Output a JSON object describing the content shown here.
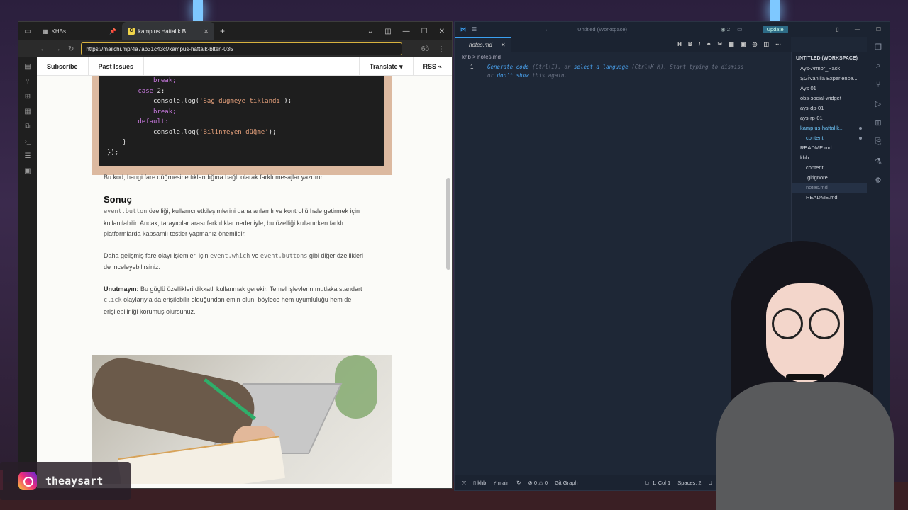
{
  "browser": {
    "tabs": [
      {
        "label": "KHBs",
        "active": false
      },
      {
        "label": "kamp.us Haftalık B...",
        "active": true
      }
    ],
    "url": "https://mailchi.mp/4a7ab31c43cf/kampus-haftalk-blten-035",
    "nav": {
      "subscribe": "Subscribe",
      "past_issues": "Past Issues",
      "translate": "Translate",
      "rss": "RSS"
    },
    "code_lines": [
      {
        "indent": "            ",
        "parts": [
          {
            "t": "break;",
            "c": "kw"
          }
        ]
      },
      {
        "indent": "        ",
        "parts": [
          {
            "t": "case",
            "c": "kw"
          },
          {
            "t": " 2:",
            "c": "fn"
          }
        ]
      },
      {
        "indent": "            ",
        "parts": [
          {
            "t": "console.log(",
            "c": "fn"
          },
          {
            "t": "'Sağ düğmeye tıklandı'",
            "c": "str"
          },
          {
            "t": ");",
            "c": "fn"
          }
        ]
      },
      {
        "indent": "            ",
        "parts": [
          {
            "t": "break;",
            "c": "kw"
          }
        ]
      },
      {
        "indent": "        ",
        "parts": [
          {
            "t": "default:",
            "c": "kw"
          }
        ]
      },
      {
        "indent": "            ",
        "parts": [
          {
            "t": "console.log(",
            "c": "fn"
          },
          {
            "t": "'Bilinmeyen düğme'",
            "c": "str"
          },
          {
            "t": ");",
            "c": "fn"
          }
        ]
      },
      {
        "indent": "    ",
        "parts": [
          {
            "t": "}",
            "c": "fn"
          }
        ]
      },
      {
        "indent": "",
        "parts": [
          {
            "t": "});",
            "c": "fn"
          }
        ]
      }
    ],
    "article": {
      "intro": "Bu kod, hangi fare düğmesine tıklandığına bağlı olarak farklı mesajlar yazdırır.",
      "heading": "Sonuç",
      "p1_code": "event.button",
      "p1_text": " özelliği, kullanıcı etkileşimlerini daha anlamlı ve kontrollü hale getirmek için kullanılabilir. Ancak, tarayıcılar arası farklılıklar nedeniyle, bu özelliği kullanırken farklı platformlarda kapsamlı testler yapmanız önemlidir.",
      "p2_a": "Daha gelişmiş fare olayı işlemleri için ",
      "p2_code1": "event.which",
      "p2_b": " ve ",
      "p2_code2": "event.buttons",
      "p2_c": " gibi diğer özellikleri de inceleyebilirsiniz.",
      "p3_bold": "Unutmayın:",
      "p3_a": " Bu güçlü özellikleri dikkatli kullanmak gerekir. Temel işlevlerin mutlaka standart ",
      "p3_code": "click",
      "p3_b": " olaylarıyla da erişilebilir olduğundan emin olun, böylece hem uyumluluğu hem de erişilebilirliği korumuş olursunuz."
    }
  },
  "vscode": {
    "search": "Untitled (Workspace)",
    "badge": "2",
    "update": "Update",
    "tab": "notes.md",
    "breadcrumb": "khb  >  notes.md",
    "line_number": "1",
    "hint": {
      "a": "Generate code",
      "b": " (Ctrl+I), or ",
      "c": "select a language",
      "d": " (Ctrl+K M). Start typing to dismiss or ",
      "e": "don't show",
      "f": " this again."
    },
    "toolbar": [
      "H",
      "B",
      "I"
    ],
    "explorer_header": "UNTITLED (WORKSPACE)",
    "explorer": [
      {
        "label": "Ays-Armor_Pack",
        "cls": "",
        "dot": false
      },
      {
        "label": "ŞGİVanilla Experience...",
        "cls": "",
        "dot": false
      },
      {
        "label": "Ays 01",
        "cls": "",
        "dot": false
      },
      {
        "label": "obs-social-widget",
        "cls": "",
        "dot": false
      },
      {
        "label": "ays-dp-01",
        "cls": "",
        "dot": false
      },
      {
        "label": "ays-rp-01",
        "cls": "",
        "dot": false
      },
      {
        "label": "kamp.us-haftalık...",
        "cls": "hl",
        "dot": true
      },
      {
        "label": "content",
        "cls": "hl i2",
        "dot": true
      },
      {
        "label": "README.md",
        "cls": "",
        "dot": false
      },
      {
        "label": "khb",
        "cls": "",
        "dot": false
      },
      {
        "label": "content",
        "cls": "i2",
        "dot": false
      },
      {
        "label": ".gitignore",
        "cls": "i2",
        "dot": false
      },
      {
        "label": "notes.md",
        "cls": "i2 sel dim",
        "dot": false
      },
      {
        "label": "README.md",
        "cls": "i2",
        "dot": false
      }
    ],
    "status": {
      "folder": "khb",
      "branch": "main",
      "problems": "⊗ 0 ⚠ 0",
      "git_graph": "Git Graph",
      "position": "Ln 1, Col 1",
      "spaces": "Spaces: 2",
      "encoding": "U"
    }
  },
  "overlay": {
    "instagram": "theaysart"
  }
}
